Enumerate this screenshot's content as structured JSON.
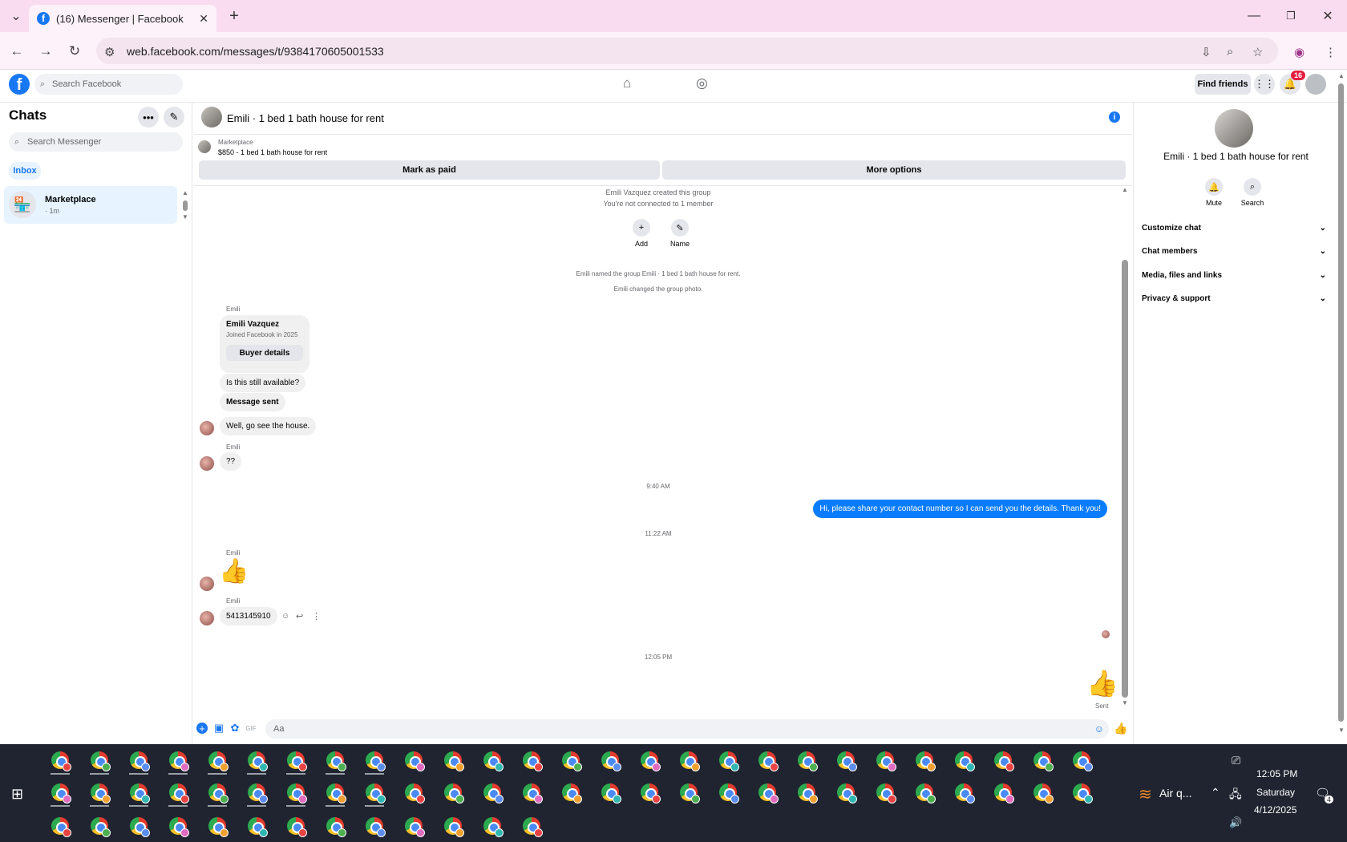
{
  "browser": {
    "tab_title": "(16) Messenger | Facebook",
    "url": "web.facebook.com/messages/t/9384170605001533"
  },
  "fb": {
    "search_placeholder": "Search Facebook",
    "find_friends": "Find friends",
    "notif_count": "16"
  },
  "sidebar": {
    "title": "Chats",
    "search_placeholder": "Search Messenger",
    "filter": "Inbox",
    "chats": [
      {
        "name": "Marketplace",
        "time": "· 1m"
      }
    ]
  },
  "conversation": {
    "title": "Emili · 1 bed 1 bath house for rent",
    "marketplace_label": "Marketplace",
    "listing": "$850 - 1 bed 1 bath house for rent",
    "mark_paid": "Mark as paid",
    "more_options": "More options",
    "sys1": "Emili Vazquez created this group",
    "sys2": "You're not connected to 1 member",
    "add_label": "Add",
    "name_label": "Name",
    "sys3": "Emili named the group Emili · 1 bed 1 bath house for rent.",
    "sys4": "Emili changed the group photo.",
    "sender": "Emili",
    "card_name": "Emili Vazquez",
    "card_sub": "Joined Facebook in 2025",
    "buyer_details": "Buyer details",
    "msg_available": "Is this still available?",
    "msg_sent_card": "Message sent",
    "msg_house": "Well, go see the house.",
    "msg_qq": "??",
    "time1": "9:40 AM",
    "msg_out": "Hi, please share your contact number so I can send you the details. Thank you!",
    "time2": "11:22 AM",
    "msg_number": "5413145910",
    "time3": "12:05 PM",
    "sent_status": "Sent",
    "composer_placeholder": "Aa"
  },
  "panel": {
    "title": "Emili · 1 bed 1 bath house for rent",
    "mute": "Mute",
    "search": "Search",
    "sections": [
      "Customize chat",
      "Chat members",
      "Media, files and links",
      "Privacy & support"
    ]
  },
  "taskbar": {
    "weather": "Air q...",
    "time": "12:05 PM",
    "day": "Saturday",
    "date": "4/12/2025",
    "notif_count": "4"
  },
  "colors": {
    "accent": "#1877f2",
    "tabbar": "#f9dcef",
    "taskbar": "#1f2430"
  }
}
